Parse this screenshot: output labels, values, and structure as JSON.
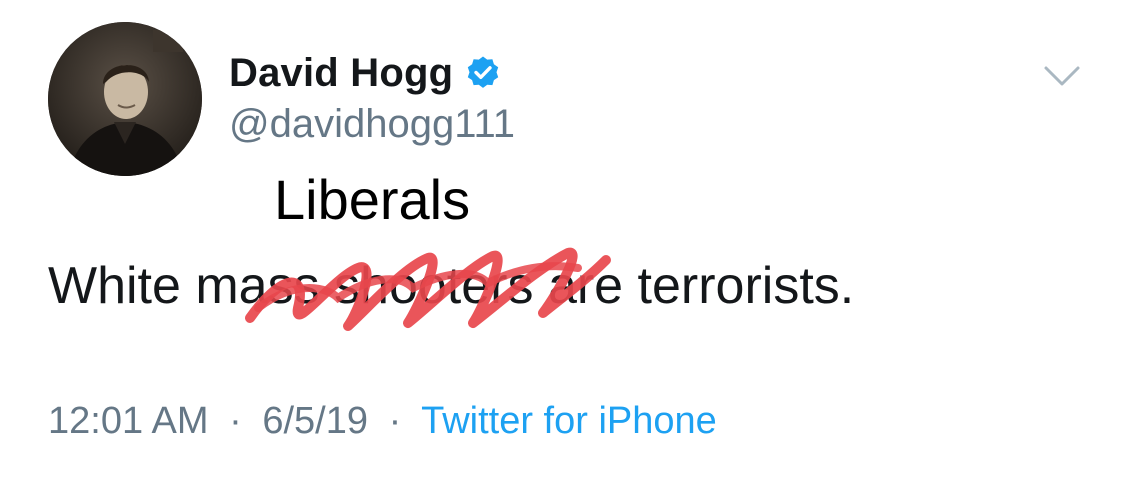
{
  "tweet": {
    "author_name": "David Hogg",
    "handle": "@davidhogg111",
    "overlay_word": "Liberals",
    "text": "White mass shooters are terrorists.",
    "time": "12:01 AM",
    "date": "6/5/19",
    "separator": "·",
    "source": "Twitter for iPhone"
  },
  "icons": {
    "verified": "verified-badge-icon",
    "menu": "chevron-down-icon"
  },
  "colors": {
    "verified_blue": "#1da1f2",
    "scribble_red": "#e8474c",
    "meta_gray": "#657786",
    "link_blue": "#1da1f2"
  }
}
